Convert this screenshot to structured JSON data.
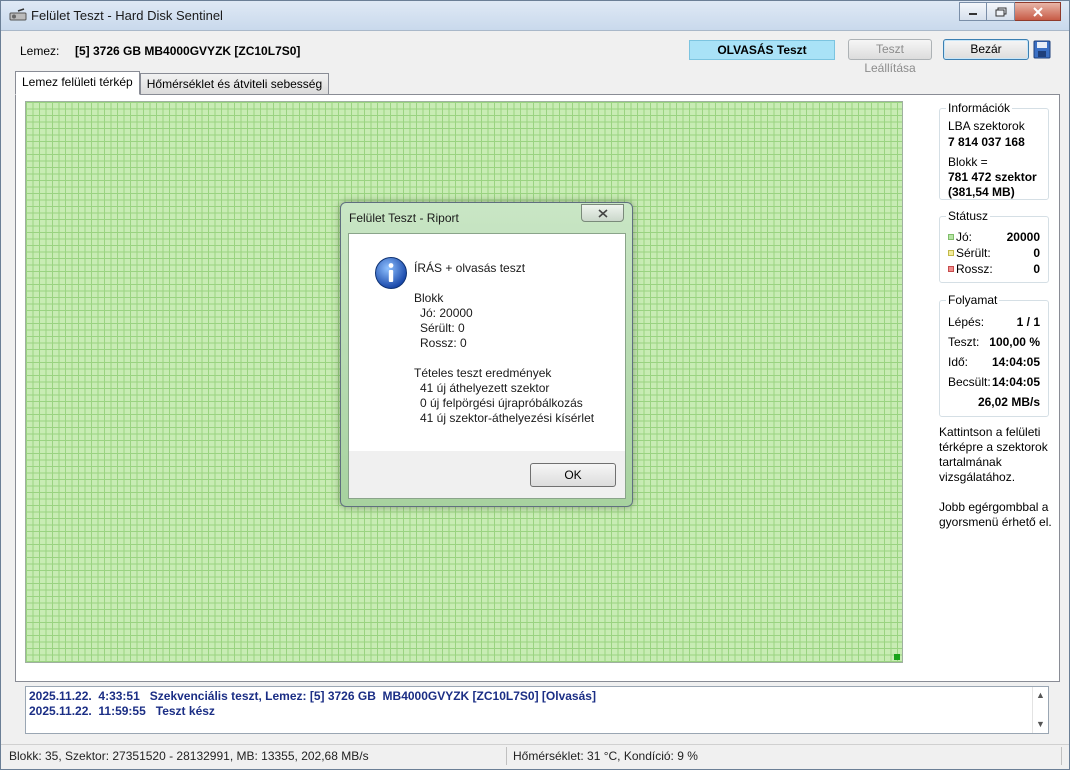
{
  "window": {
    "title": "Felület Teszt - Hard Disk Sentinel"
  },
  "toolbar": {
    "disk_label": "Lemez:",
    "disk_value": "[5] 3726 GB  MB4000GVYZK [ZC10L7S0]",
    "status": "OLVASÁS Teszt",
    "stop_button": "Teszt Leállítása",
    "close_button": "Bezár"
  },
  "tabs": [
    {
      "label": "Lemez felületi térkép",
      "active": true
    },
    {
      "label": "Hőmérséklet és átviteli sebesség",
      "active": false
    }
  ],
  "info": {
    "title": "Információk",
    "lba_label": "LBA szektorok",
    "lba_value": "7 814 037 168",
    "block_label": "Blokk =",
    "block_value": "781 472 szektor",
    "block_size": "(381,54 MB)"
  },
  "status": {
    "title": "Státusz",
    "good_label": "Jó:",
    "good_value": "20000",
    "damaged_label": "Sérült:",
    "damaged_value": "0",
    "bad_label": "Rossz:",
    "bad_value": "0"
  },
  "progress": {
    "title": "Folyamat",
    "step_label": "Lépés:",
    "step_value": "1 / 1",
    "test_label": "Teszt:",
    "test_value": "100,00 %",
    "time_label": "Idő:",
    "time_value": "14:04:05",
    "est_label": "Becsült:",
    "est_value": "14:04:05",
    "speed": "26,02 MB/s"
  },
  "hints": {
    "click": "Kattintson a felületi térképre a szektorok tartalmának vizsgálatához.",
    "menu": "Jobb egérgombbal a gyorsmenü érhető el."
  },
  "log": [
    "2025.11.22.  4:33:51   Szekvenciális teszt, Lemez: [5] 3726 GB  MB4000GVYZK [ZC10L7S0] [Olvasás]",
    "2025.11.22.  11:59:55   Teszt kész"
  ],
  "statusbar": {
    "left": "Blokk: 35, Szektor: 27351520 - 28132991, MB: 13355, 202,68 MB/s",
    "right": "Hőmérséklet: 31  °C,  Kondíció: 9 %"
  },
  "dialog": {
    "title": "Felület Teszt - Riport",
    "heading": "ÍRÁS + olvasás teszt",
    "block_title": "Blokk",
    "good": "Jó: 20000",
    "damaged": "Sérült: 0",
    "bad": "Rossz: 0",
    "results_title": "Tételes teszt eredmények",
    "result1": "41 új áthelyezett szektor",
    "result2": "0 új felpörgési újrapróbálkozás",
    "result3": "41 új szektor-áthelyezési kísérlet",
    "ok_button": "OK"
  },
  "colors": {
    "map_good": "#c8ecb4",
    "status_highlight": "#a9e2f7",
    "log_text": "#1b2e85"
  }
}
